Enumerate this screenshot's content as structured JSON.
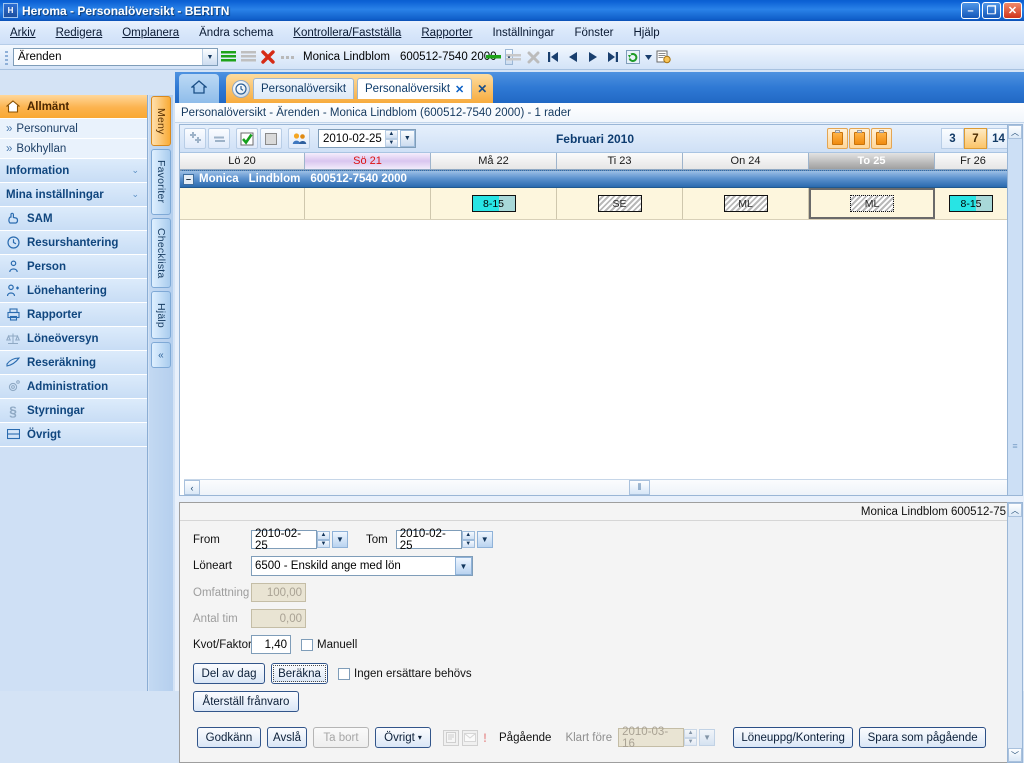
{
  "window": {
    "title": "Heroma - Personalöversikt - BERITN",
    "icon": "app-icon",
    "minimize": "–",
    "restore": "❐",
    "close": "✕"
  },
  "menubar": {
    "items": [
      {
        "label": "Arkiv"
      },
      {
        "label": "Redigera"
      },
      {
        "label": "Omplanera"
      },
      {
        "label": "Ändra schema"
      },
      {
        "label": "Kontrollera/Fastställa"
      },
      {
        "label": "Rapporter"
      },
      {
        "label": "Inställningar"
      },
      {
        "label": "Fönster"
      },
      {
        "label": "Hjälp"
      }
    ]
  },
  "toolbar": {
    "combo_value": "Ärenden",
    "person_name": "Monica Lindblom",
    "person_id": "600512-7540 2000",
    "icons": [
      "green-lines-icon",
      "gray-lines-icon",
      "red-x-icon",
      "ellipsis-icon",
      "first-record-icon",
      "previous-record-icon",
      "next-record-icon",
      "last-record-icon",
      "refresh-icon",
      "refresh-dropdown-icon",
      "print-preview-icon"
    ]
  },
  "sidebar": {
    "items": [
      {
        "label": "Allmänt",
        "icon": "home-icon",
        "type": "header",
        "active": true
      },
      {
        "label": "Personurval",
        "icon": "chevron-right-icon",
        "type": "sub"
      },
      {
        "label": "Bokhyllan",
        "icon": "chevron-right-icon",
        "type": "sub"
      },
      {
        "label": "Information",
        "icon": "",
        "type": "group",
        "chevron": "⌄"
      },
      {
        "label": "Mina inställningar",
        "icon": "",
        "type": "group",
        "chevron": "⌄"
      },
      {
        "label": "SAM",
        "icon": "hand-icon",
        "type": "header"
      },
      {
        "label": "Resurshantering",
        "icon": "clock-icon",
        "type": "header"
      },
      {
        "label": "Person",
        "icon": "person-icon",
        "type": "header"
      },
      {
        "label": "Lönehantering",
        "icon": "user-pay-icon",
        "type": "header"
      },
      {
        "label": "Rapporter",
        "icon": "printer-icon",
        "type": "header"
      },
      {
        "label": "Löneöversyn",
        "icon": "scales-icon",
        "type": "header"
      },
      {
        "label": "Reseräkning",
        "icon": "plane-icon",
        "type": "header"
      },
      {
        "label": "Administration",
        "icon": "gear-icon",
        "type": "header"
      },
      {
        "label": "Styrningar",
        "icon": "paragraph-icon",
        "type": "header"
      },
      {
        "label": "Övrigt",
        "icon": "list-icon",
        "type": "header"
      }
    ],
    "vtabs": [
      {
        "label": "Meny",
        "active": true
      },
      {
        "label": "Favoriter",
        "active": false
      },
      {
        "label": "Checklista",
        "active": false
      },
      {
        "label": "Hjälp",
        "active": false
      }
    ],
    "collapse_label": "«"
  },
  "tabstrip": {
    "home_icon": "home-icon",
    "group_icon": "clock-icon",
    "tabs": [
      {
        "label": "Personalöversikt",
        "selected": false,
        "closable": false
      },
      {
        "label": "Personalöversikt",
        "selected": true,
        "closable": true,
        "close": "✕"
      }
    ],
    "close_all": "✕"
  },
  "pathbar": {
    "text": "Personalöversikt - Ärenden - Monica Lindblom (600512-7540 2000) - 1 rader"
  },
  "schedule": {
    "toolbar": {
      "buttons": [
        {
          "name": "add-icon",
          "glyph": "✛"
        },
        {
          "name": "equals-icon",
          "glyph": "="
        },
        {
          "name": "checkbox-checked-icon",
          "glyph": "✔"
        },
        {
          "name": "checkbox-empty-icon",
          "glyph": "▢"
        },
        {
          "name": "people-icon",
          "glyph": "👥"
        }
      ],
      "date_value": "2010-02-25",
      "month_label": "Februari 2010",
      "clipboard_buttons": [
        "clipboard-icon-1",
        "clipboard-icon-2",
        "clipboard-icon-3"
      ],
      "week_buttons": [
        {
          "label": "3",
          "active": false
        },
        {
          "label": "7",
          "active": true
        },
        {
          "label": "14",
          "active": false
        }
      ]
    },
    "days": [
      {
        "label": "Lö 20",
        "type": "saturday",
        "width": 125
      },
      {
        "label": "Sö 21",
        "type": "sunday",
        "width": 126
      },
      {
        "label": "Må 22",
        "type": "weekday",
        "width": 126
      },
      {
        "label": "Ti 23",
        "type": "weekday",
        "width": 126
      },
      {
        "label": "On 24",
        "type": "weekday",
        "width": 126
      },
      {
        "label": "To 25",
        "type": "today",
        "width": 126
      },
      {
        "label": "Fr 26",
        "type": "weekday",
        "width": 77
      }
    ],
    "employee": {
      "expander": "–",
      "first_name": "Monica",
      "last_name": "Lindblom",
      "id": "600512-7540 2000"
    },
    "shifts": [
      {
        "day": "Lö 20",
        "chip": null
      },
      {
        "day": "Sö 21",
        "chip": null
      },
      {
        "day": "Må 22",
        "chip": {
          "label": "8-15",
          "style": "time"
        }
      },
      {
        "day": "Ti 23",
        "chip": {
          "label": "SE",
          "style": "hatch"
        }
      },
      {
        "day": "On 24",
        "chip": {
          "label": "ML",
          "style": "hatch"
        }
      },
      {
        "day": "To 25",
        "chip": {
          "label": "ML",
          "style": "hatch-dotted"
        },
        "selected": true
      },
      {
        "day": "Fr 26",
        "chip": {
          "label": "8-15",
          "style": "time"
        }
      }
    ],
    "hscroll": {
      "left_arrow": "‹",
      "thumb": "⦀"
    },
    "vscroll": {
      "up_arrow": "︿",
      "grip": "≡"
    }
  },
  "detail": {
    "header_text": "Monica Lindblom 600512-75",
    "from_label": "From",
    "from_value": "2010-02-25",
    "tom_label": "Tom",
    "tom_value": "2010-02-25",
    "loneart_label": "Löneart",
    "loneart_value": "6500 - Enskild ange med lön",
    "omfattning_label": "Omfattning",
    "omfattning_value": "100,00",
    "antal_tim_label": "Antal tim",
    "antal_tim_value": "0,00",
    "kvot_label": "Kvot/Faktor",
    "kvot_value": "1,40",
    "manuell_label": "Manuell",
    "del_av_dag_label": "Del av dag",
    "berakna_label": "Beräkna",
    "ingen_ersattare_label": "Ingen ersättare behövs",
    "aterstall_label": "Återställ frånvaro",
    "godkann_label": "Godkänn",
    "avsla_label": "Avslå",
    "ta_bort_label": "Ta bort",
    "ovrigt_label": "Övrigt",
    "ovrigt_arrow": "▾",
    "pagaende_label": "Pågående",
    "klart_fore_label": "Klart före",
    "klart_fore_value": "2010-03-16",
    "loneuppg_label": "Löneuppg/Kontering",
    "spara_label": "Spara som pågående",
    "flat_icons": [
      "note-icon",
      "envelope-icon",
      "exclamation-icon"
    ]
  }
}
